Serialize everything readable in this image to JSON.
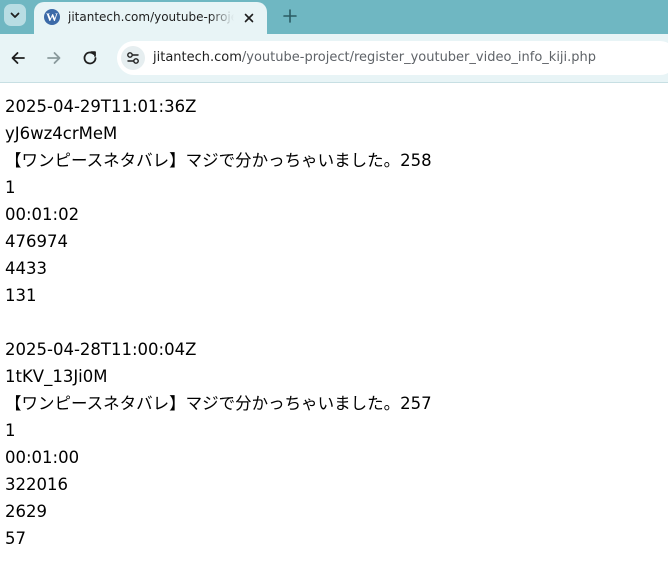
{
  "browser": {
    "tab": {
      "title": "jitantech.com/youtube-project/register_youtuber_video_info_kiji.php",
      "favicon": "wordpress-icon"
    },
    "address_bar": {
      "host": "jitantech.com",
      "path": "/youtube-project/register_youtuber_video_info_kiji.php"
    },
    "colors": {
      "tabstrip": "#6fb7c2",
      "toolbar": "#e8f4f6"
    }
  },
  "videos": [
    {
      "published_at": "2025-04-29T11:01:36Z",
      "video_id": "yJ6wz4crMeM",
      "title": "【ワンピースネタバレ】マジで分かっちゃいました。258",
      "flag": "1",
      "duration": "00:01:02",
      "views": "476974",
      "likes": "4433",
      "comments": "131"
    },
    {
      "published_at": "2025-04-28T11:00:04Z",
      "video_id": "1tKV_13Ji0M",
      "title": "【ワンピースネタバレ】マジで分かっちゃいました。257",
      "flag": "1",
      "duration": "00:01:00",
      "views": "322016",
      "likes": "2629",
      "comments": "57"
    }
  ]
}
